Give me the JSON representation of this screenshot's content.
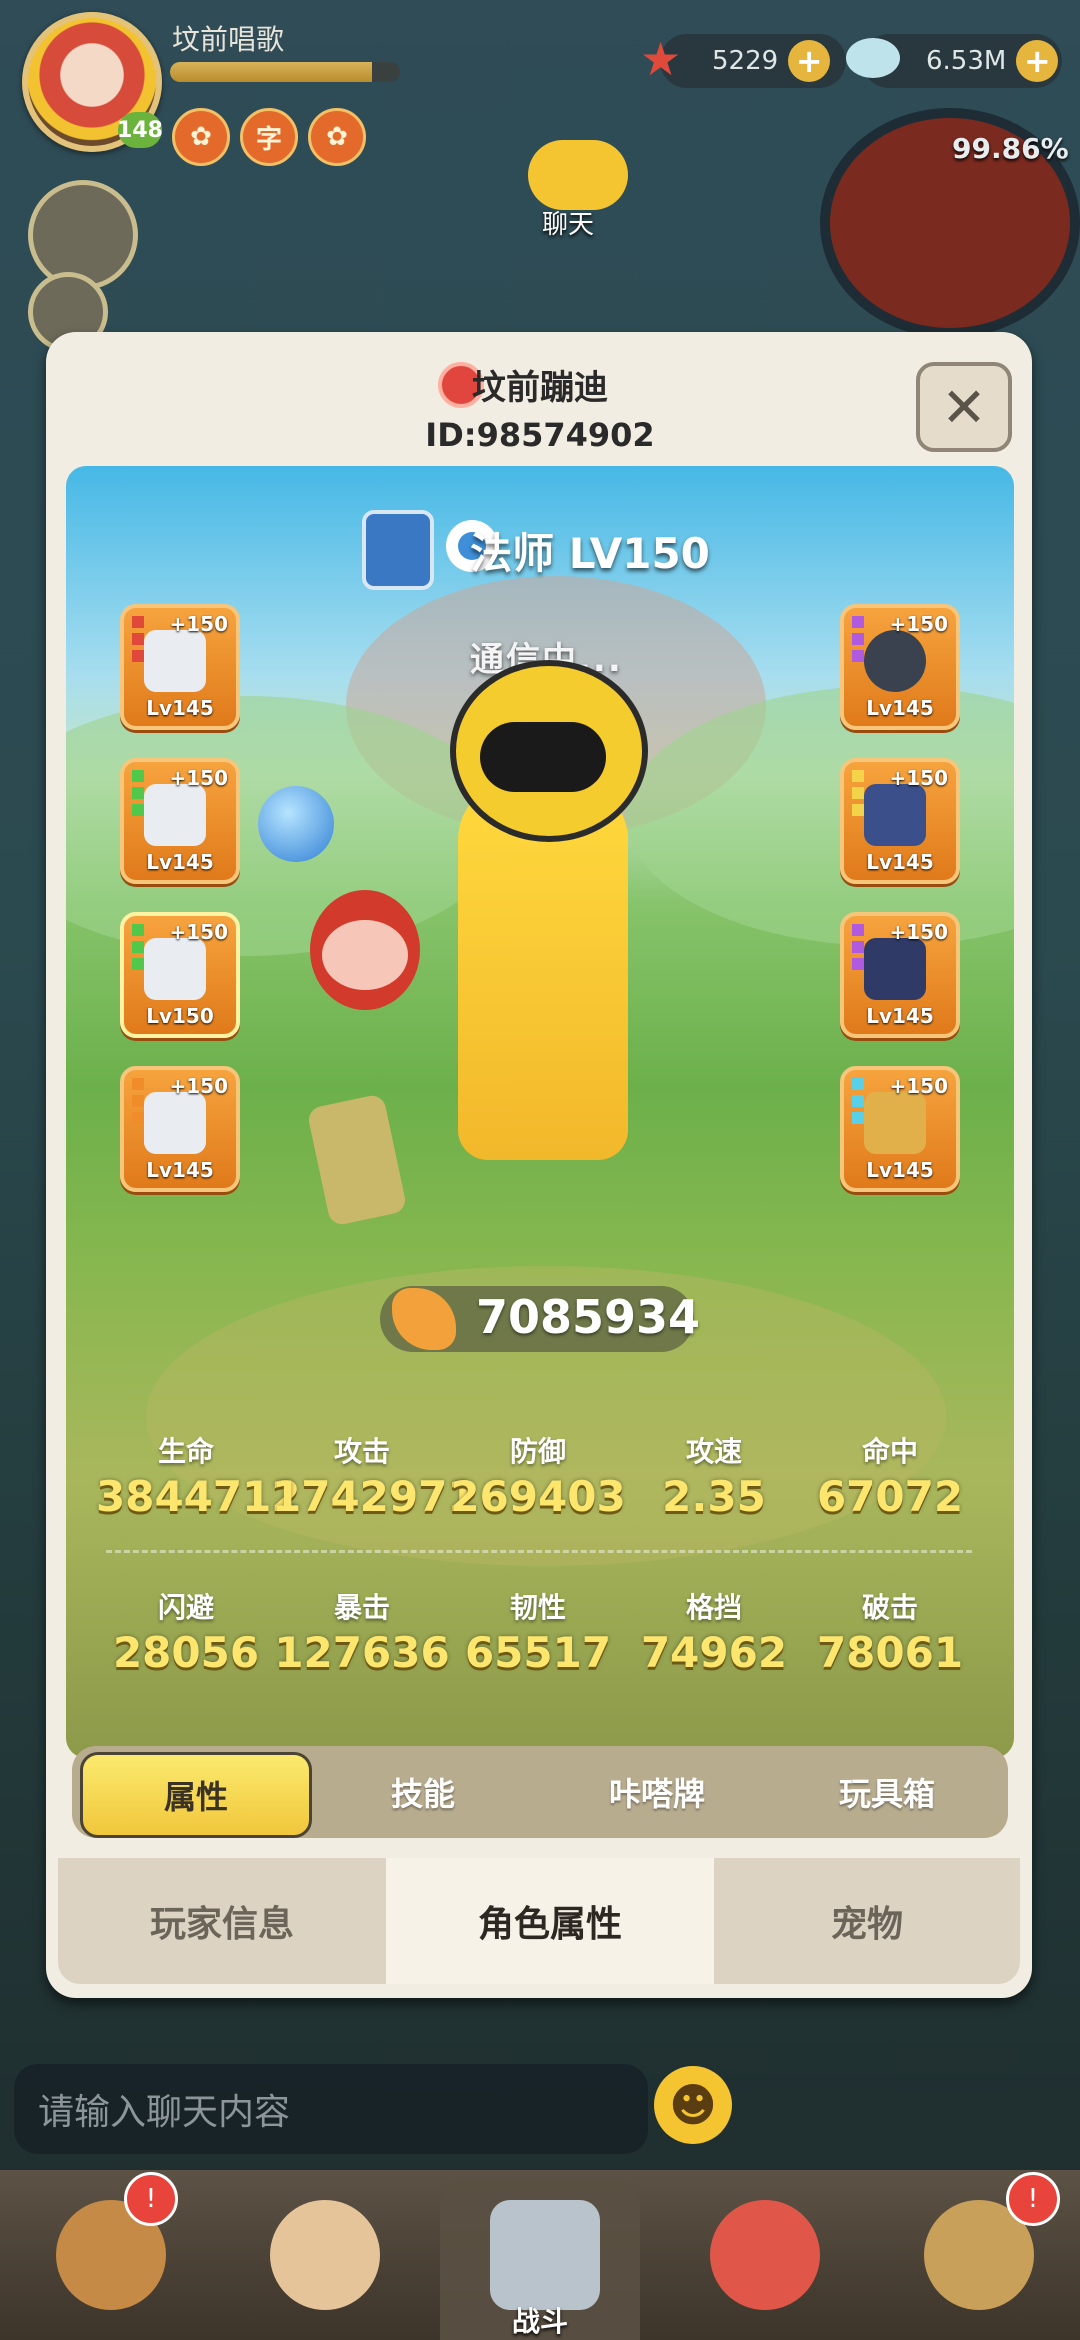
{
  "hud": {
    "player_name": "坟前唱歌",
    "level": "148",
    "badges": [
      "✿",
      "字",
      "✿"
    ],
    "starfish_count": "5229",
    "shell_count": "6.53M",
    "map_progress": "99.86%",
    "chat_label": "聊天"
  },
  "panel": {
    "player_name": "坟前蹦迪",
    "player_id": "ID:98574902",
    "close_symbol": "✕",
    "class_label": "法师 LV150",
    "status": "通信中..."
  },
  "equipment": {
    "left": [
      {
        "plus": "+150",
        "level": "Lv145",
        "gem": "#e0483a"
      },
      {
        "plus": "+150",
        "level": "Lv145",
        "gem": "#52c84a"
      },
      {
        "plus": "+150",
        "level": "Lv150",
        "gem": "#52c84a"
      },
      {
        "plus": "+150",
        "level": "Lv145",
        "gem": "#f08c2a"
      }
    ],
    "right": [
      {
        "plus": "+150",
        "level": "Lv145",
        "gem": "#b05ae0"
      },
      {
        "plus": "+150",
        "level": "Lv145",
        "gem": "#f2d34a"
      },
      {
        "plus": "+150",
        "level": "Lv145",
        "gem": "#b05ae0"
      },
      {
        "plus": "+150",
        "level": "Lv145",
        "gem": "#5ad0e8"
      }
    ]
  },
  "power": "7085934",
  "stats": {
    "row1": [
      {
        "label": "生命",
        "value": "3844712"
      },
      {
        "label": "攻击",
        "value": "1742971"
      },
      {
        "label": "防御",
        "value": "269403"
      },
      {
        "label": "攻速",
        "value": "2.35"
      },
      {
        "label": "命中",
        "value": "67072"
      }
    ],
    "row2": [
      {
        "label": "闪避",
        "value": "28056"
      },
      {
        "label": "暴击",
        "value": "127636"
      },
      {
        "label": "韧性",
        "value": "65517"
      },
      {
        "label": "格挡",
        "value": "74962"
      },
      {
        "label": "破击",
        "value": "78061"
      }
    ]
  },
  "sub_tabs": [
    "属性",
    "技能",
    "咔嗒牌",
    "玩具箱"
  ],
  "main_tabs": [
    "玩家信息",
    "角色属性",
    "宠物"
  ],
  "chat_input": {
    "placeholder": "请输入聊天内容",
    "emoji": "☻"
  },
  "bottom_nav": {
    "battle_label": "战斗",
    "alert": "!"
  },
  "colors": {
    "accent": "#f1c73b",
    "panel_bg": "#f2ede2",
    "stat_value": "#fde66d"
  }
}
